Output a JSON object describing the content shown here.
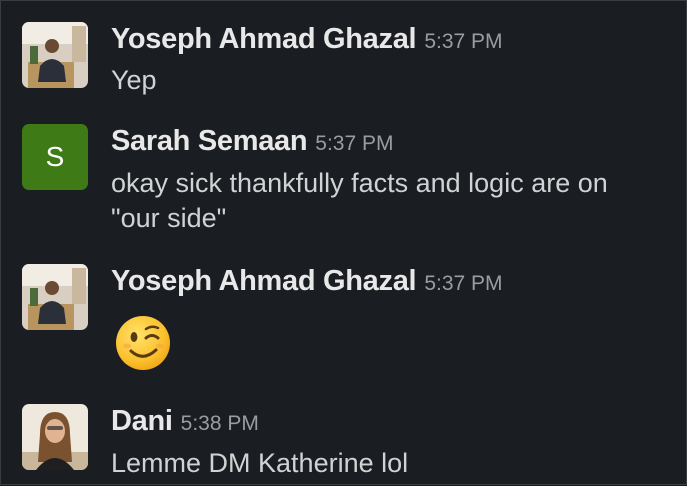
{
  "messages": [
    {
      "sender": "Yoseph Ahmad Ghazal",
      "time": "5:37 PM",
      "text": "Yep",
      "avatar": "photo"
    },
    {
      "sender": "Sarah Semaan",
      "time": "5:37 PM",
      "text": "okay sick thankfully facts and logic are on \"our side\"",
      "avatar": "initial",
      "avatar_initial": "S",
      "avatar_color": "#3e7b16"
    },
    {
      "sender": "Yoseph Ahmad Ghazal",
      "time": "5:37 PM",
      "emoji": "winking-face",
      "avatar": "photo"
    },
    {
      "sender": "Dani",
      "time": "5:38 PM",
      "text": "Lemme DM Katherine lol",
      "avatar": "photo"
    }
  ],
  "colors": {
    "background": "#1a1d21",
    "sender_name": "#e8e8e8",
    "timestamp": "#9b9c9e",
    "message_text": "#d1d2d3"
  }
}
